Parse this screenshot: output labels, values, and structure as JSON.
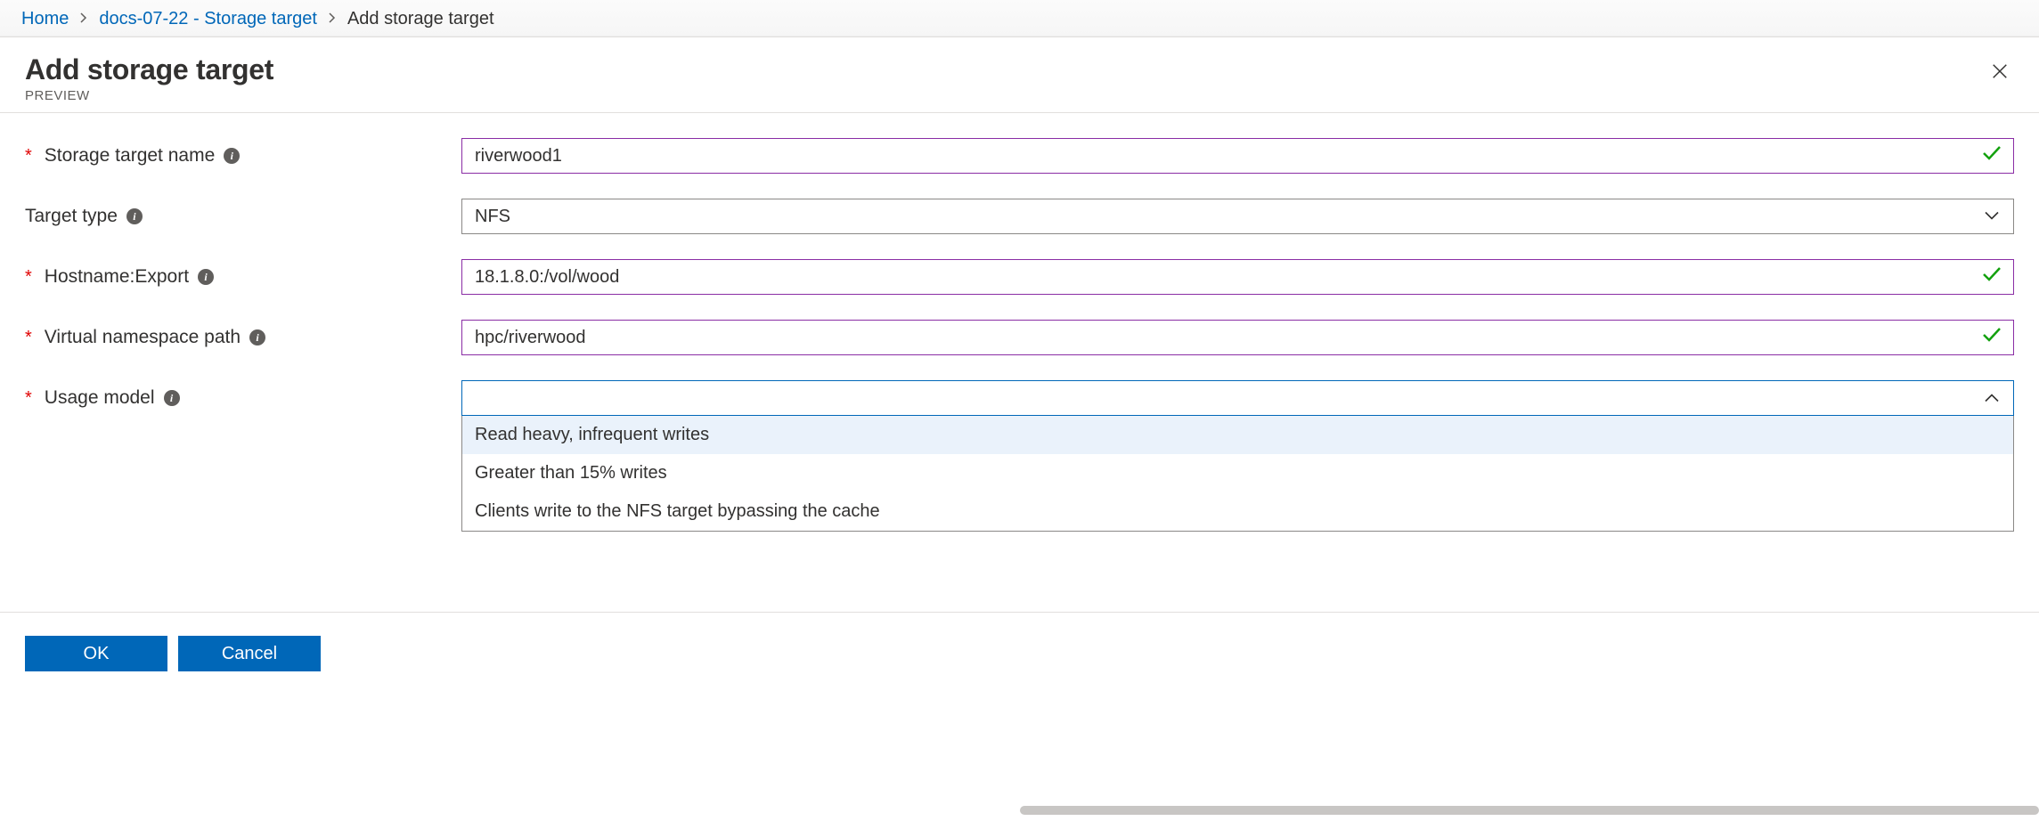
{
  "breadcrumb": {
    "home": "Home",
    "resource": "docs-07-22 - Storage target",
    "current": "Add storage target"
  },
  "header": {
    "title": "Add storage target",
    "subtitle": "PREVIEW"
  },
  "form": {
    "name": {
      "label": "Storage target name",
      "value": "riverwood1"
    },
    "type": {
      "label": "Target type",
      "value": "NFS"
    },
    "hostname": {
      "label": "Hostname:Export",
      "value": "18.1.8.0:/vol/wood"
    },
    "vnamespace": {
      "label": "Virtual namespace path",
      "value": "hpc/riverwood"
    },
    "usage": {
      "label": "Usage model",
      "value": "",
      "options": [
        "Read heavy, infrequent writes",
        "Greater than 15% writes",
        "Clients write to the NFS target bypassing the cache"
      ]
    }
  },
  "footer": {
    "ok": "OK",
    "cancel": "Cancel"
  }
}
